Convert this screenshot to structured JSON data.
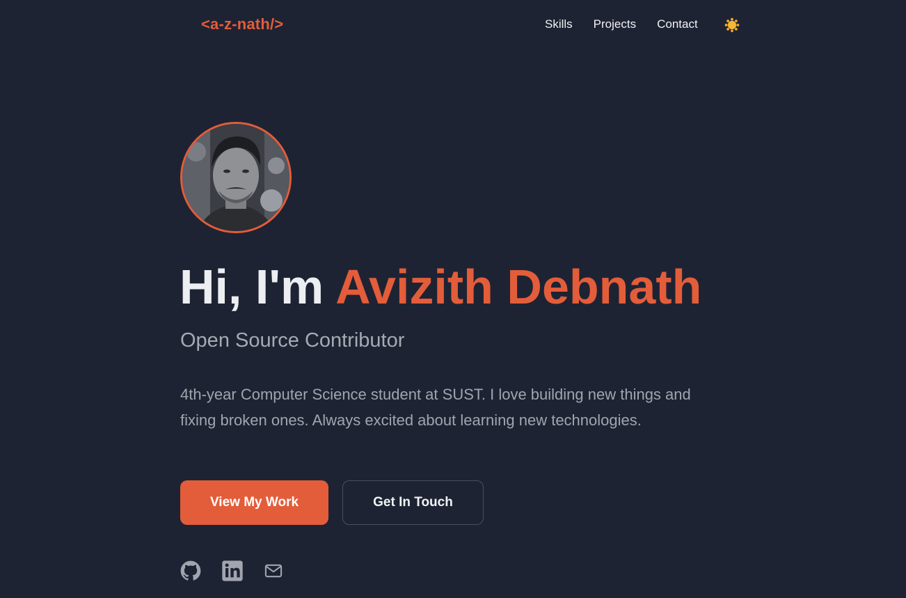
{
  "header": {
    "logo_text": "<a-z-nath/>",
    "nav": [
      {
        "label": "Skills"
      },
      {
        "label": "Projects"
      },
      {
        "label": "Contact"
      }
    ],
    "theme_icon": "sun-icon"
  },
  "hero": {
    "avatar_alt": "profile-photo",
    "greeting": "Hi, I'm ",
    "name": "Avizith Debnath",
    "subtitle": "Open Source Contributor",
    "description": "4th-year Computer Science student at SUST. I love building new things and fixing broken ones. Always excited about learning new technologies.",
    "primary_button": "View My Work",
    "secondary_button": "Get In Touch"
  },
  "social": [
    {
      "icon": "github-icon"
    },
    {
      "icon": "linkedin-icon"
    },
    {
      "icon": "mail-icon"
    }
  ],
  "colors": {
    "background": "#1e2333",
    "accent": "#e35d3a",
    "text": "#eceef2",
    "muted_text": "#a2a5ae"
  }
}
